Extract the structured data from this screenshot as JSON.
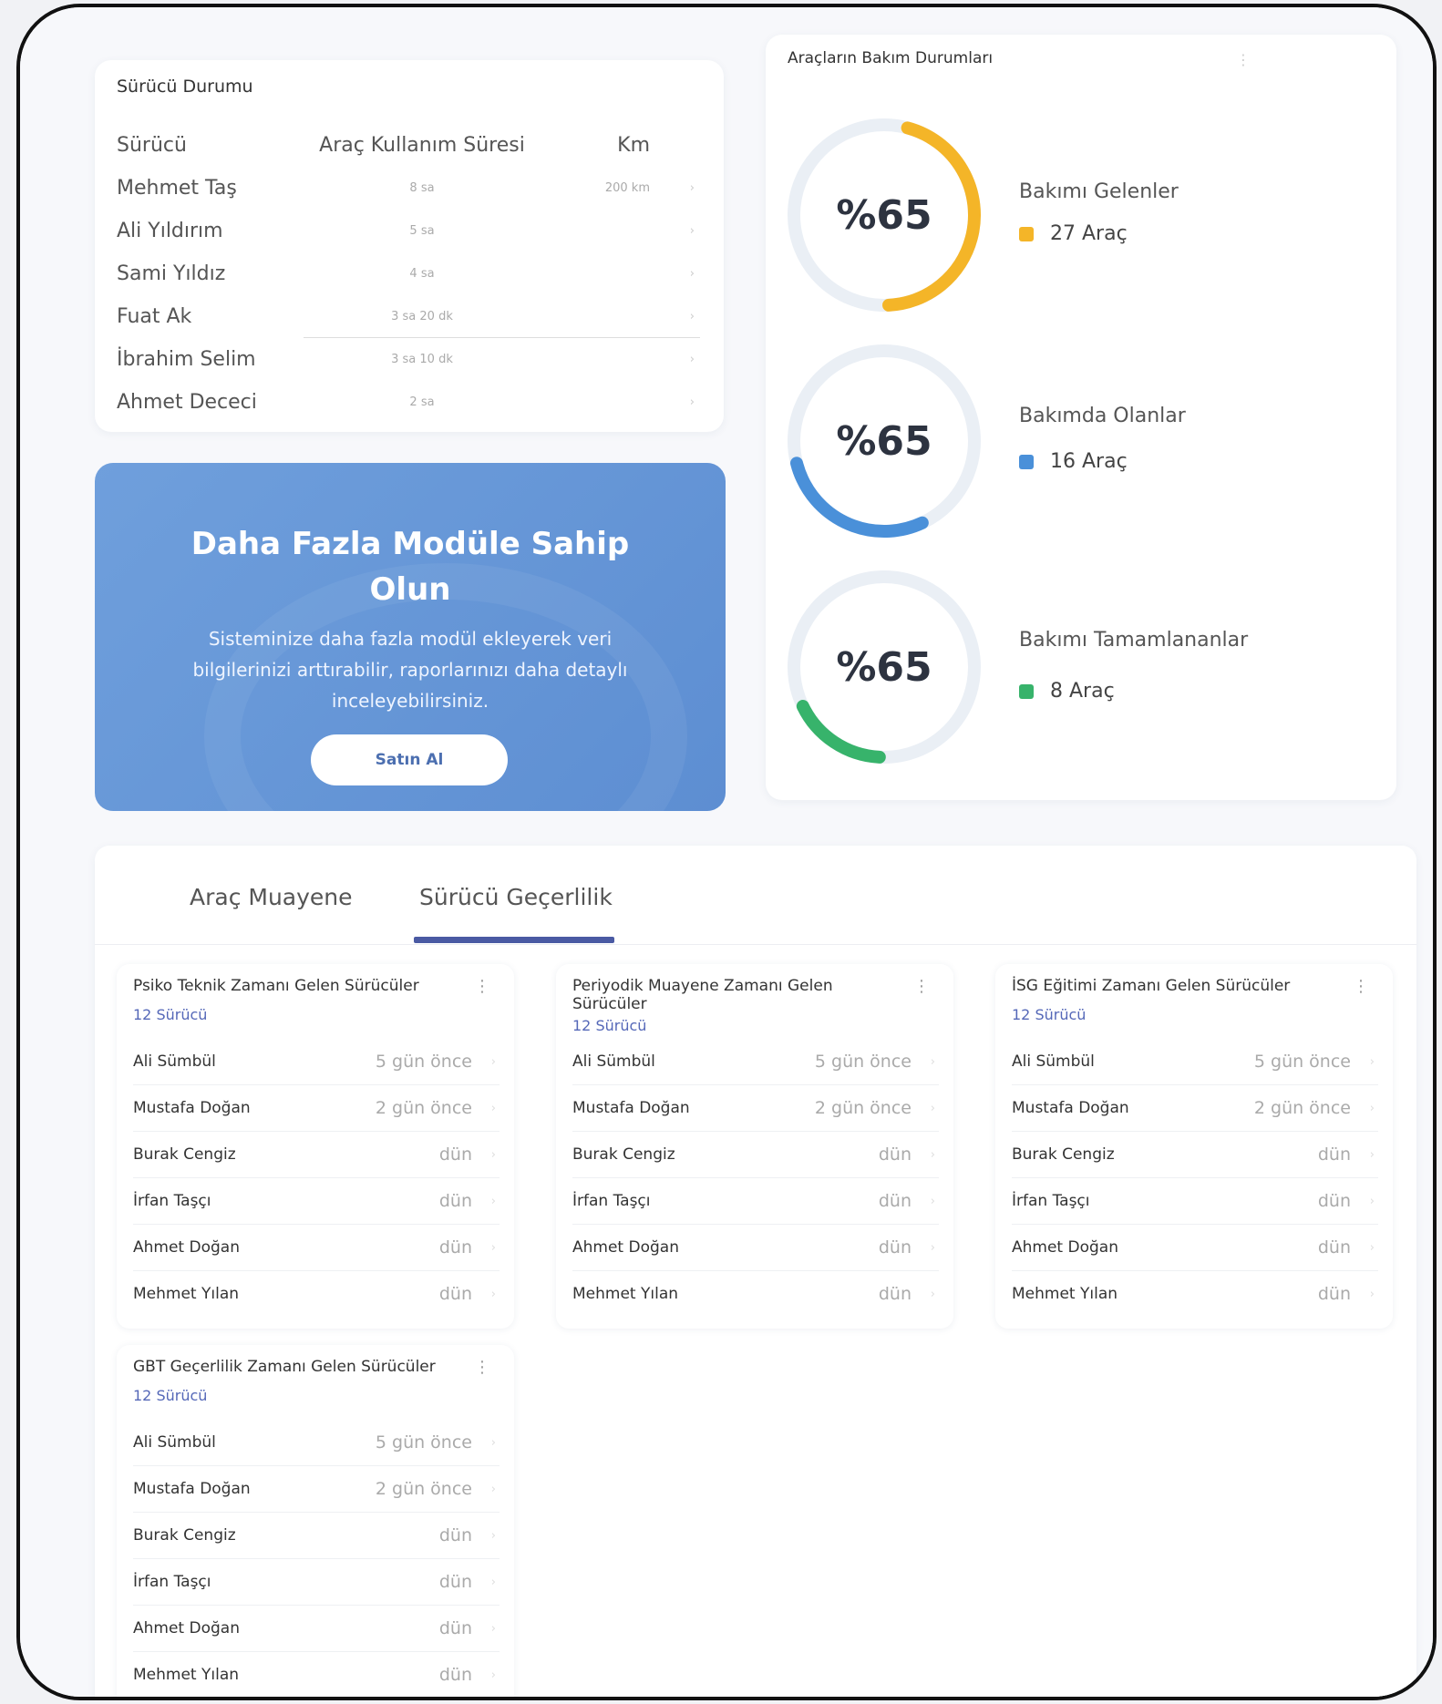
{
  "driver_status": {
    "title": "Sürücü Durumu",
    "headers": [
      "Sürücü",
      "Araç Kullanım Süresi",
      "Km"
    ],
    "rows": [
      {
        "name": "Mehmet Taş",
        "duration": "8 sa",
        "km": "200 km"
      },
      {
        "name": "Ali Yıldırım",
        "duration": "5 sa",
        "km": ""
      },
      {
        "name": "Sami Yıldız",
        "duration": "4 sa",
        "km": ""
      },
      {
        "name": "Fuat Ak",
        "duration": "3 sa 20 dk",
        "km": ""
      },
      {
        "name": "İbrahim Selim",
        "duration": "3 sa 10 dk",
        "km": ""
      },
      {
        "name": "Ahmet Dececi",
        "duration": "2 sa",
        "km": ""
      }
    ]
  },
  "promo": {
    "title": "Daha Fazla Modüle Sahip Olun",
    "text": "Sisteminize daha fazla modül ekleyerek veri bilgilerinizi arttırabilir, raporlarınızı daha detaylı inceleyebilirsiniz.",
    "button": "Satın Al"
  },
  "maintenance": {
    "title": "Araçların Bakım Durumları",
    "items": [
      {
        "label": "Bakımı Gelenler",
        "count": "27 Araç",
        "pct_text": "%65",
        "fraction": 0.45,
        "start_deg": 15,
        "color": "#f4b528"
      },
      {
        "label": "Bakımda Olanlar",
        "count": "16 Araç",
        "pct_text": "%65",
        "fraction": 0.28,
        "start_deg": 155,
        "color": "#4a90d9"
      },
      {
        "label": "Bakımı Tamamlananlar",
        "count": "8 Araç",
        "pct_text": "%65",
        "fraction": 0.17,
        "start_deg": 183,
        "color": "#37b36b"
      }
    ]
  },
  "tabs": [
    "Araç Muayene",
    "Sürücü Geçerlilik"
  ],
  "lists": [
    {
      "title": "Psiko Teknik Zamanı Gelen Sürücüler",
      "count": "12 Sürücü",
      "rows": [
        {
          "name": "Ali Sümbül",
          "time": "5 gün önce"
        },
        {
          "name": "Mustafa Doğan",
          "time": "2 gün önce"
        },
        {
          "name": "Burak Cengiz",
          "time": "dün"
        },
        {
          "name": "İrfan Taşçı",
          "time": "dün"
        },
        {
          "name": "Ahmet Doğan",
          "time": "dün"
        },
        {
          "name": "Mehmet Yılan",
          "time": "dün"
        }
      ]
    },
    {
      "title": "Periyodik Muayene Zamanı Gelen Sürücüler",
      "count": "12 Sürücü",
      "rows": [
        {
          "name": "Ali Sümbül",
          "time": "5 gün önce"
        },
        {
          "name": "Mustafa Doğan",
          "time": "2 gün önce"
        },
        {
          "name": "Burak Cengiz",
          "time": "dün"
        },
        {
          "name": "İrfan Taşçı",
          "time": "dün"
        },
        {
          "name": "Ahmet Doğan",
          "time": "dün"
        },
        {
          "name": "Mehmet Yılan",
          "time": "dün"
        }
      ]
    },
    {
      "title": "İSG Eğitimi Zamanı Gelen Sürücüler",
      "count": "12 Sürücü",
      "rows": [
        {
          "name": "Ali Sümbül",
          "time": "5 gün önce"
        },
        {
          "name": "Mustafa Doğan",
          "time": "2 gün önce"
        },
        {
          "name": "Burak Cengiz",
          "time": "dün"
        },
        {
          "name": "İrfan Taşçı",
          "time": "dün"
        },
        {
          "name": "Ahmet Doğan",
          "time": "dün"
        },
        {
          "name": "Mehmet Yılan",
          "time": "dün"
        }
      ]
    },
    {
      "title": "GBT Geçerlilik Zamanı Gelen Sürücüler",
      "count": "12 Sürücü",
      "rows": [
        {
          "name": "Ali Sümbül",
          "time": "5 gün önce"
        },
        {
          "name": "Mustafa Doğan",
          "time": "2 gün önce"
        },
        {
          "name": "Burak Cengiz",
          "time": "dün"
        },
        {
          "name": "İrfan Taşçı",
          "time": "dün"
        },
        {
          "name": "Ahmet Doğan",
          "time": "dün"
        },
        {
          "name": "Mehmet Yılan",
          "time": "dün"
        }
      ]
    }
  ],
  "icons": {
    "row_arrow": "chevron-right-icon",
    "menu": "kebab-menu-icon"
  }
}
